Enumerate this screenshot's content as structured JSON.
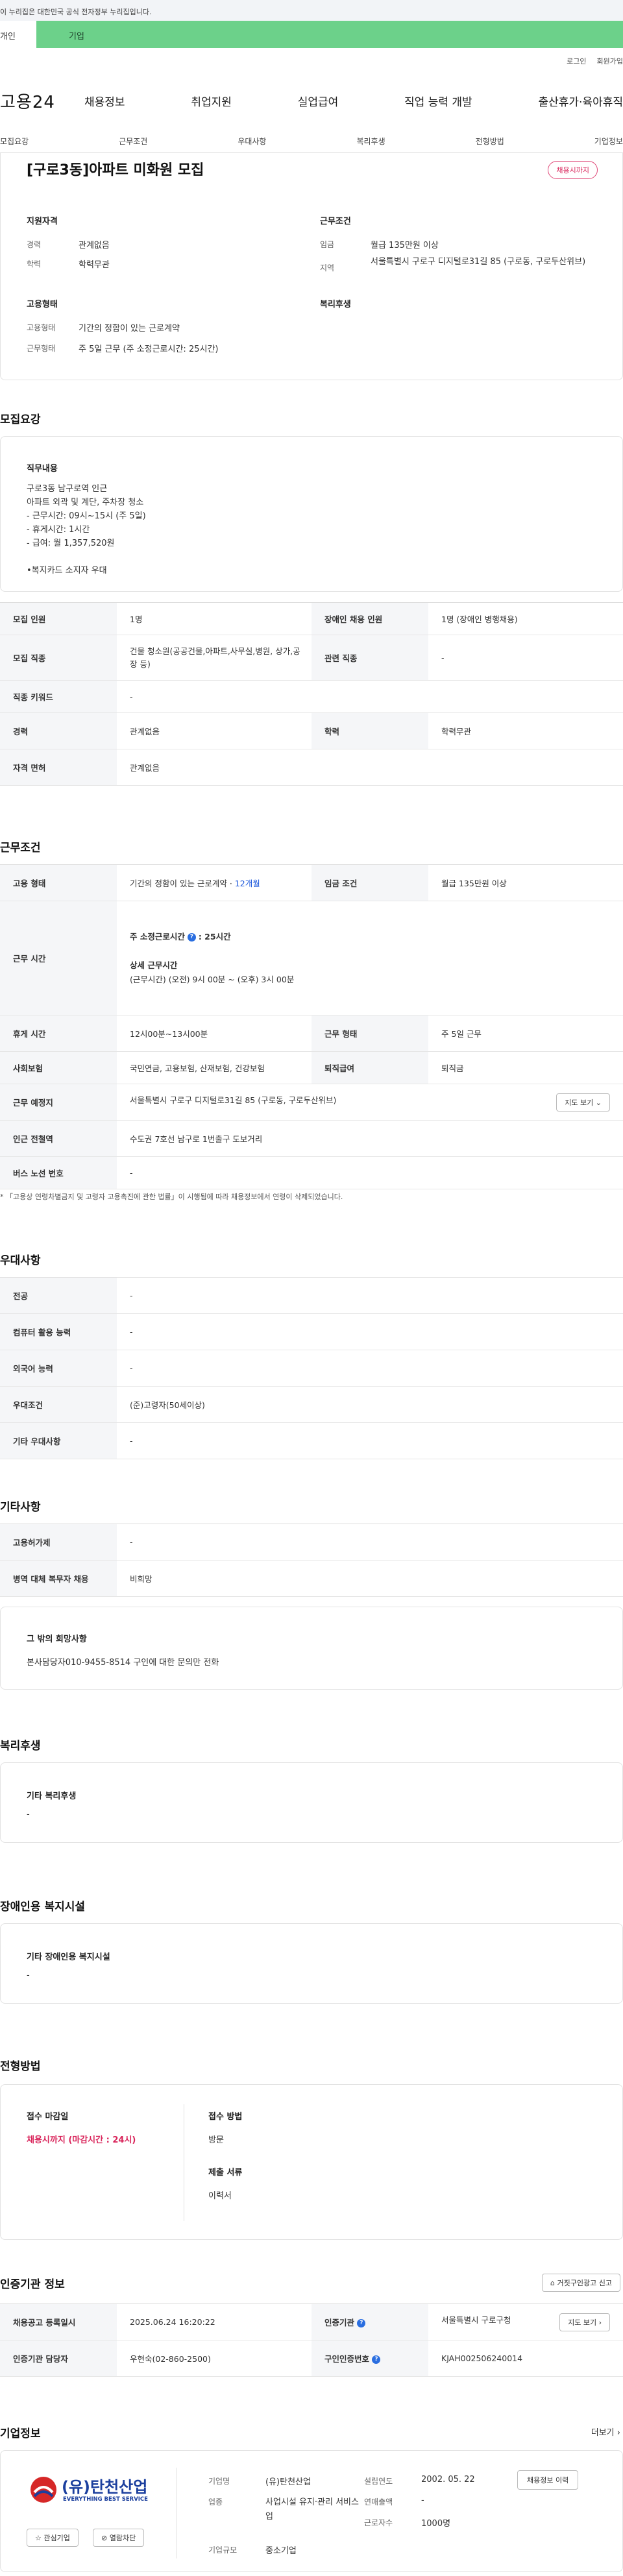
{
  "gov_banner": "이 누리집은 대한민국 공식 전자정부 누리집입니다.",
  "user_tabs": {
    "personal": "개인",
    "company": "기업"
  },
  "top_links": {
    "login": "로그인",
    "join": "회원가입"
  },
  "logo": "고용24",
  "gnb": [
    "채용정보",
    "취업지원",
    "실업급여",
    "직업 능력 개발",
    "출산휴가·육아휴직"
  ],
  "anchor_tabs": [
    "모집요강",
    "근무조건",
    "우대사항",
    "복리후생",
    "전형방법",
    "기업정보"
  ],
  "summary": {
    "title": "[구로3동]아파트 미화원 모집",
    "badge": "채용시까지",
    "qual_title": "지원자격",
    "career_label": "경력",
    "career_value": "관계없음",
    "edu_label": "학력",
    "edu_value": "학력무관",
    "cond_title": "근무조건",
    "wage_label": "임금",
    "wage_value": "월급 135만원 이상",
    "region_label": "지역",
    "region_value": "서울특별시 구로구 디지털로31길 85 (구로동, 구로두산위브)",
    "emp_title": "고용형태",
    "emp_label": "고용형태",
    "emp_value": "기간의 정함이 있는 근로계약",
    "worktype_label": "근무형태",
    "worktype_value": "주 5일 근무 (주 소정근로시간: 25시간)",
    "welfare_title": "복리후생"
  },
  "recruit": {
    "heading": "모집요강",
    "duty_title": "직무내용",
    "duty_lines": [
      "구로3동 남구로역 인근",
      "아파트 외곽 및 계단, 주차장 청소",
      "- 근무시간: 09시~15시 (주 5일)",
      "- 휴게시간: 1시간",
      "- 급여: 월 1,357,520원",
      "",
      "•복지카드 소지자 우대"
    ],
    "table": {
      "r1": [
        "모집 인원",
        "1명",
        "장애인 채용 인원",
        "1명 (장애인 병행채용)"
      ],
      "r2": [
        "모집 직종",
        "건물 청소원(공공건물,아파트,사무실,병원, 상가,공장 등)",
        "관련 직종",
        "-"
      ],
      "r3": [
        "직종 키워드",
        "-"
      ],
      "r4": [
        "경력",
        "관계없음",
        "학력",
        "학력무관"
      ],
      "r5": [
        "자격 면허",
        "관계없음"
      ]
    }
  },
  "work": {
    "heading": "근무조건",
    "emp_th": "고용 형태",
    "emp_val": "기간의 정함이 있는 근로계약 · ",
    "emp_months": "12개월",
    "wage_th": "임금 조건",
    "wage_val": "월급 135만원 이상",
    "time_th": "근무 시간",
    "std_hours_label": "주 소정근로시간",
    "std_hours_val": ": 25시간",
    "detail_label": "상세 근무시간",
    "detail_val": "(근무시간) (오전) 9시 00분 ~ (오후) 3시 00분",
    "rest_th": "휴게 시간",
    "rest_val": "12시00분~13시00분",
    "form_th": "근무 형태",
    "form_val": "주 5일 근무",
    "ins_th": "사회보험",
    "ins_val": "국민연금, 고용보험, 산재보험, 건강보험",
    "sev_th": "퇴직급여",
    "sev_val": "퇴직금",
    "place_th": "근무 예정지",
    "place_val": "서울특별시 구로구 디지털로31길 85 (구로동, 구로두산위브)",
    "map_btn": "지도 보기",
    "subway_th": "인근 전철역",
    "subway_val": "수도권 7호선 남구로 1번출구 도보거리",
    "bus_th": "버스 노선 번호",
    "bus_val": "-",
    "footnote": "* 「고용상 연령차별금지 및 고령자 고용촉진에 관한 법률」이 시행됨에 따라 채용정보에서 연령이 삭제되었습니다."
  },
  "pref": {
    "heading": "우대사항",
    "rows": [
      [
        "전공",
        "-"
      ],
      [
        "컴퓨터 활용 능력",
        "-"
      ],
      [
        "외국어 능력",
        "-"
      ],
      [
        "우대조건",
        "(준)고령자(50세이상)"
      ],
      [
        "기타 우대사항",
        "-"
      ]
    ]
  },
  "etc": {
    "heading": "기타사항",
    "rows": [
      [
        "고용허가제",
        "-"
      ],
      [
        "병역 대체 복무자 채용",
        "비희망"
      ]
    ],
    "box_title": "그 밖의 희망사항",
    "box_text": "본사담당자010-9455-8514 구인에 대한 문의만 전화"
  },
  "welfare": {
    "heading": "복리후생",
    "box_title": "기타 복리후생",
    "box_text": "-"
  },
  "disab": {
    "heading": "장애인용 복지시설",
    "box_title": "기타 장애인용 복지시설",
    "box_text": "-"
  },
  "screening": {
    "heading": "전형방법",
    "deadline_title": "접수 마감일",
    "deadline_val": "채용시까지 (마감시간 : 24시)",
    "method_title": "접수 방법",
    "method_val": "방문",
    "docs_title": "제출 서류",
    "docs_val": "이력서"
  },
  "cert": {
    "heading": "인증기관 정보",
    "report_btn": "거짓구인광고 신고",
    "r1": [
      "채용공고 등록일시",
      "2025.06.24 16:20:22",
      "인증기관",
      "서울특별시 구로구청"
    ],
    "r2": [
      "인증기관 담당자",
      "우현숙(02-860-2500)",
      "구인인증번호",
      "KJAH002506240014"
    ],
    "map_btn": "지도 보기"
  },
  "company": {
    "heading": "기업정보",
    "more": "더보기",
    "logo_text": "(유)탄천산업",
    "logo_sub": "EVERYTHING BEST SERVICE",
    "fav_btn": "관심기업",
    "block_btn": "열람차단",
    "name_label": "기업명",
    "name_val": "(유)탄천산업",
    "biz_label": "업종",
    "biz_val": "사업시설 유지·관리 서비스업",
    "size_label": "기업규모",
    "size_val": "중소기업",
    "year_label": "설립연도",
    "year_val": "2002. 05. 22",
    "sales_label": "연매출액",
    "sales_val": "-",
    "staff_label": "근로자수",
    "staff_val": "1000명",
    "history_btn": "채용정보 이력"
  },
  "colors": {
    "accent_green": "#6cd18a",
    "red": "#d9245a",
    "blue": "#1a56db"
  }
}
